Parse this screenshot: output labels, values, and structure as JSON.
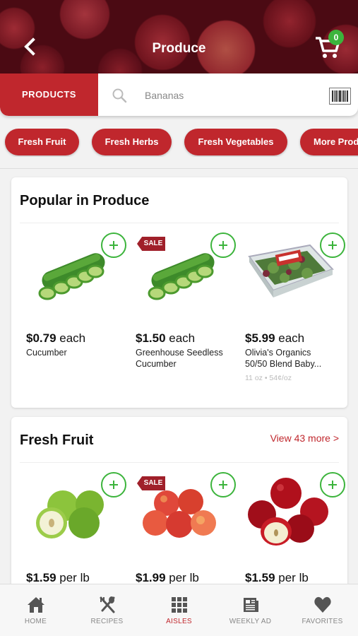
{
  "header": {
    "title": "Produce",
    "cart_count": "0"
  },
  "search": {
    "tab_label": "PRODUCTS",
    "placeholder": "Bananas"
  },
  "categories": [
    "Fresh Fruit",
    "Fresh Herbs",
    "Fresh Vegetables",
    "More Prod"
  ],
  "popular": {
    "title": "Popular in Produce",
    "products": [
      {
        "price": "$0.79",
        "unit": " each",
        "name": "Cucumber",
        "size": "",
        "sale": false,
        "icon": "cucumber-image"
      },
      {
        "price": "$1.50",
        "unit": " each",
        "name": "Greenhouse Seedless Cucumber",
        "size": "",
        "sale": true,
        "sale_label": "SALE",
        "icon": "cucumber-image"
      },
      {
        "price": "$5.99",
        "unit": " each",
        "name": "Olivia's Organics 50/50 Blend Baby...",
        "size": "11 oz • 54¢/oz",
        "sale": false,
        "icon": "salad-box-image"
      }
    ]
  },
  "fresh_fruit": {
    "title": "Fresh Fruit",
    "view_more": "View 43 more >",
    "products": [
      {
        "price": "$1.59",
        "unit": " per lb",
        "sale": false,
        "icon": "green-apple-image"
      },
      {
        "price": "$1.99",
        "unit": " per lb",
        "sale": true,
        "sale_label": "SALE",
        "icon": "gala-apple-image"
      },
      {
        "price": "$1.59",
        "unit": " per lb",
        "sale": false,
        "icon": "red-apple-image"
      }
    ]
  },
  "nav": {
    "items": [
      {
        "label": "HOME",
        "icon": "home-icon",
        "active": false
      },
      {
        "label": "RECIPES",
        "icon": "recipes-icon",
        "active": false
      },
      {
        "label": "AISLES",
        "icon": "aisles-icon",
        "active": true
      },
      {
        "label": "WEEKLY AD",
        "icon": "weekly-ad-icon",
        "active": false
      },
      {
        "label": "FAVORITES",
        "icon": "favorites-icon",
        "active": false
      }
    ]
  },
  "colors": {
    "brand_red": "#c0272d",
    "add_green": "#3cb43c"
  }
}
